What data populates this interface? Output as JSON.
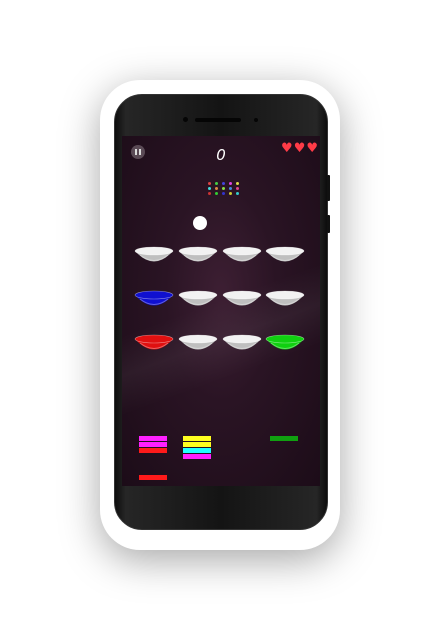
{
  "game": {
    "score": "0",
    "lives": 3,
    "heart_glyph": "♥",
    "pause_icon": "pause-icon"
  },
  "dot_grid": {
    "colors": [
      "#d44",
      "#4c4",
      "#44d",
      "#d4d",
      "#dd4",
      "#4dd",
      "#d84",
      "#8d4",
      "#48d",
      "#d48",
      "#c33",
      "#3c3",
      "#33c",
      "#cc3",
      "#3cc"
    ]
  },
  "bowls": {
    "rows": [
      [
        "#d8d8d8",
        "#d8d8d8",
        "#d8d8d8",
        "#d8d8d8"
      ],
      [
        "#1010d0",
        "#d8d8d8",
        "#d8d8d8",
        "#d8d8d8"
      ],
      [
        "#e01010",
        "#d8d8d8",
        "#d8d8d8",
        "#10d010"
      ]
    ]
  },
  "stacks": [
    {
      "name": "stack-left",
      "colors": [
        "#ff20ff",
        "#ff20ff",
        "#ff1a1a"
      ]
    },
    {
      "name": "stack-middle",
      "colors": [
        "#ffff20",
        "#ffff20",
        "#20ffff",
        "#ff20ff"
      ]
    },
    {
      "name": "stack-right",
      "colors": [
        "#10a010"
      ]
    },
    {
      "name": "stack-bottom",
      "colors": [
        "#ff1a1a"
      ]
    }
  ]
}
